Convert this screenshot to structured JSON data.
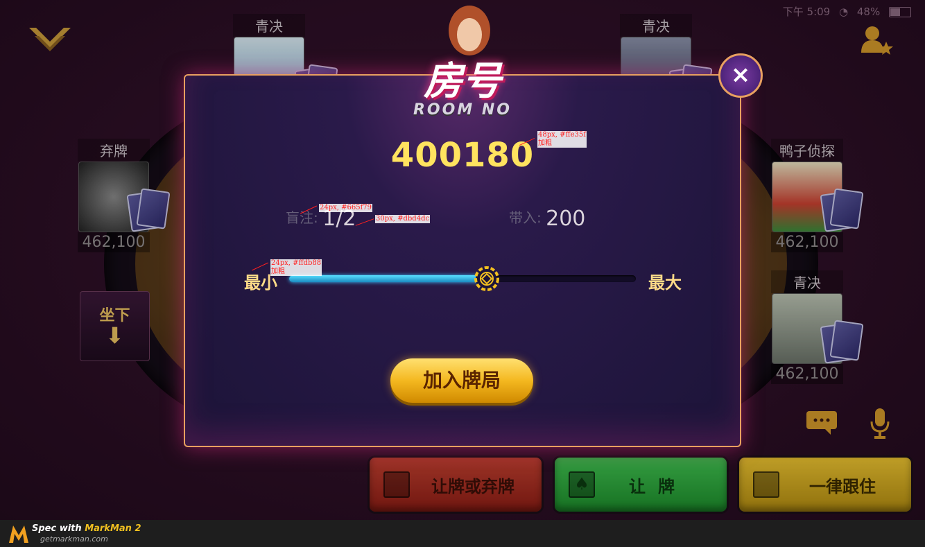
{
  "status_bar": {
    "time": "下午 5:09",
    "battery": "48%"
  },
  "seats": [
    {
      "id": "top-left",
      "name": "青决"
    },
    {
      "id": "top-right",
      "name": "青决"
    },
    {
      "id": "left",
      "name": "弃牌",
      "chips": "462,100"
    },
    {
      "id": "right-top",
      "name": "鸭子侦探",
      "chips": "462,100"
    },
    {
      "id": "right-bottom",
      "name": "青决",
      "chips": "462,100"
    }
  ],
  "sit_down": {
    "label": "坐下"
  },
  "actions": [
    {
      "label": "让牌或弃牌",
      "color": "#a82a20"
    },
    {
      "label": "让牌",
      "color": "#2aa83a"
    },
    {
      "label": "一律跟住",
      "color": "#d8b020"
    }
  ],
  "dialog": {
    "title_cn": "房号",
    "title_en": "ROOM NO",
    "close_label": "×",
    "room_number": "400180",
    "blind_label": "盲注:",
    "blind_value": "1/2",
    "buyin_label": "带入:",
    "buyin_value": "200",
    "slider_min_label": "最小",
    "slider_max_label": "最大",
    "slider_level": 0.57,
    "join_label": "加入牌局"
  },
  "annotations": {
    "room_number": [
      "48px, #ffe35f",
      "加粗"
    ],
    "blind_label": "24px, #665f79",
    "blind_value": "30px, #dbd4dc",
    "slider_label": [
      "24px, #ffdb88",
      "加粗"
    ]
  },
  "watermark": {
    "line1_prefix": "Spec with",
    "line1_brand": "MarkMan 2",
    "line2": "getmarkman.com"
  },
  "colors": {
    "room_number": "#ffe35f",
    "blind_label": "#665f79",
    "blind_value": "#dbd4dc",
    "slider_label": "#ffdb88"
  }
}
